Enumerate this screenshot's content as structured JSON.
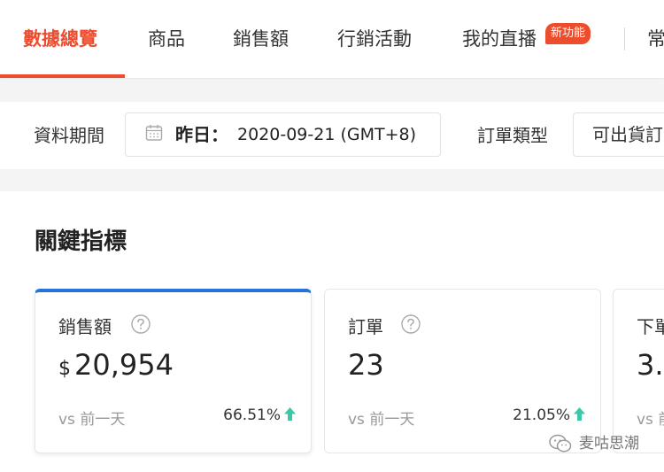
{
  "nav": {
    "tabs": [
      {
        "label": "數據總覽",
        "active": true
      },
      {
        "label": "商品",
        "active": false
      },
      {
        "label": "銷售額",
        "active": false
      },
      {
        "label": "行銷活動",
        "active": false
      },
      {
        "label": "我的直播",
        "active": false,
        "badge": "新功能"
      },
      {
        "label": "常",
        "active": false
      }
    ],
    "accent_color": "#ee4d2d"
  },
  "filters": {
    "period_label": "資料期間",
    "period_prefix": "昨日：",
    "period_value": "2020-09-21 (GMT+8)",
    "order_type_label": "訂單類型",
    "order_type_value": "可出貨訂"
  },
  "key_metrics": {
    "title": "關鍵指標",
    "selected_color": "#2673dd",
    "up_color": "#3cc7a7",
    "cards": [
      {
        "title": "銷售額",
        "currency": "$",
        "value": "20,954",
        "compare_label": "vs 前一天",
        "change": "66.51%",
        "trend": "up"
      },
      {
        "title": "訂單",
        "value": "23",
        "compare_label": "vs 前一天",
        "change": "21.05%",
        "trend": "up"
      },
      {
        "title": "下單",
        "value": "3.",
        "compare_label": "vs 前"
      }
    ]
  },
  "watermark": {
    "icon": "wechat-icon",
    "text": "麦咕思潮"
  }
}
